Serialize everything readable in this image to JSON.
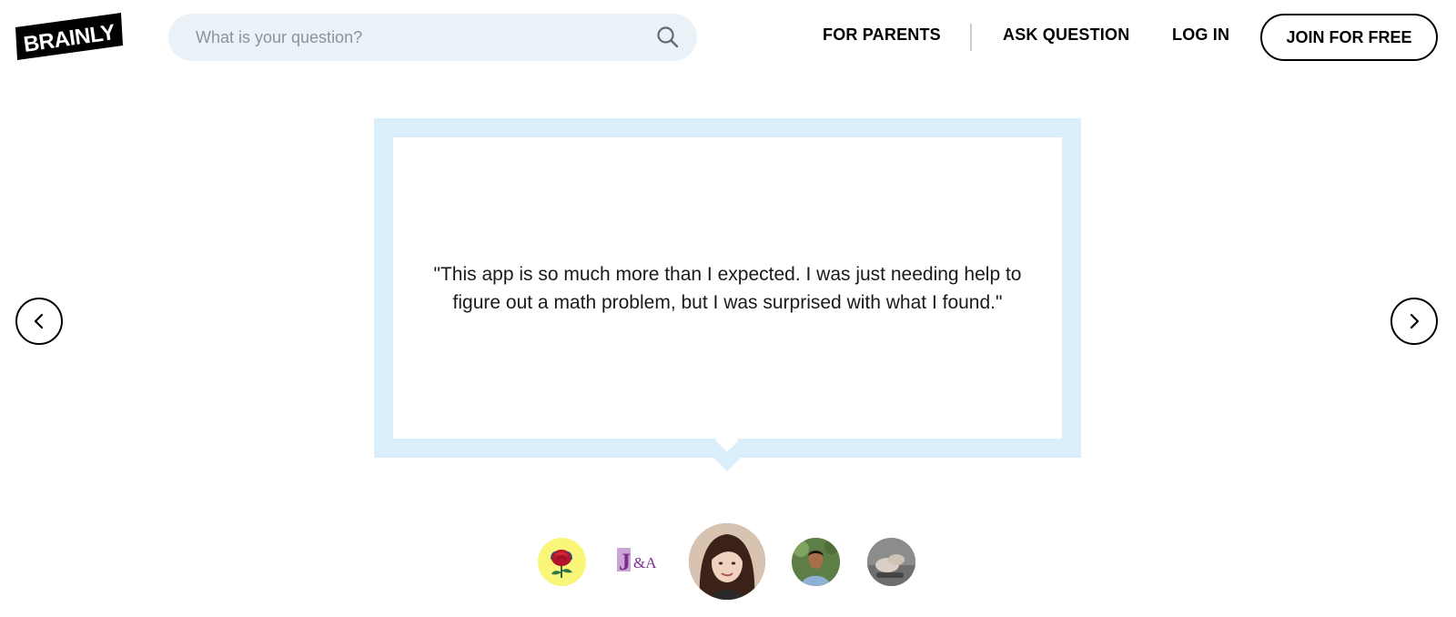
{
  "header": {
    "logo_text": "BRAINLY",
    "search": {
      "placeholder": "What is your question?",
      "value": ""
    },
    "nav": {
      "for_parents": "FOR PARENTS",
      "ask_question": "ASK QUESTION",
      "log_in": "LOG IN",
      "join": "JOIN FOR FREE"
    }
  },
  "testimonial": {
    "quote": "\"This app is so much more than I expected. I was just needing help to figure out a math problem, but I was surprised with what I found.\"",
    "active_index": 2
  },
  "avatars": [
    {
      "name": "rose-avatar",
      "icon": "rose"
    },
    {
      "name": "ja-avatar",
      "logo_text": "J&A"
    },
    {
      "name": "woman-avatar",
      "icon": "portrait"
    },
    {
      "name": "man-avatar",
      "icon": "portrait"
    },
    {
      "name": "hands-avatar",
      "icon": "photo"
    }
  ],
  "colors": {
    "quote_frame": "#daeefc",
    "search_bg": "#ebf2f7",
    "rose_avatar_bg": "#faf67a"
  }
}
